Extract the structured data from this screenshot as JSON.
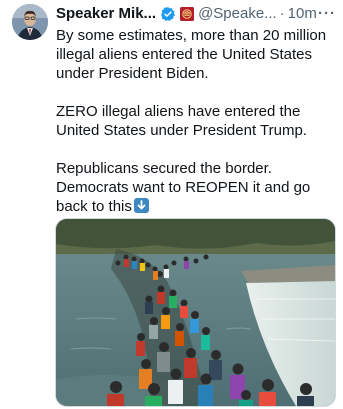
{
  "author": {
    "name": "Speaker Mik...",
    "handle": "@Speake...",
    "separator": "·",
    "time": "10m",
    "verified_icon": "verified-badge-icon",
    "affiliation_icon": "house-seal-icon"
  },
  "more_label": "···",
  "tweet": {
    "paragraph_1": "By some estimates, more than 20 million illegal aliens entered the United States under President Biden.",
    "paragraph_2": "ZERO illegal aliens have entered the United States under President Trump.",
    "paragraph_3": "Republicans secured the border. Democrats want to REOPEN it and go back to this",
    "emoji": "down-arrow-emoji"
  },
  "colors": {
    "text": "#0f1419",
    "secondary_text": "#536471",
    "verified_blue": "#1d9bf0",
    "emoji_blue": "#3b88c3"
  },
  "media": {
    "type": "photo",
    "subject": "crowd-crossing-river-photo"
  }
}
